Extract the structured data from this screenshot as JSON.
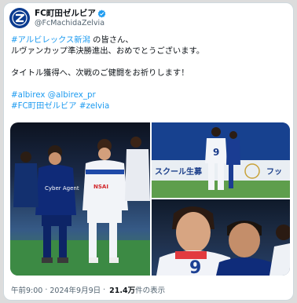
{
  "account": {
    "display_name": "FC町田ゼルビア",
    "handle": "@FcMachidaZelvia",
    "verified": true
  },
  "tweet": {
    "line1_tag": "#アルビレックス新潟",
    "line1_rest": " の皆さん、",
    "line2": "ルヴァンカップ準決勝進出、おめでとうございます。",
    "line3": "タイトル獲得へ、次戦のご健闘をお祈りします！",
    "line4_tag": "#albirex",
    "line4_mention": "@albirex_pr",
    "line5_tag1": "#FC町田ゼルビア",
    "line5_tag2": "#zelvia"
  },
  "media": {
    "sign_text": "スクール生募",
    "sign_text2": "フッ",
    "photo2_number": "9",
    "photo3_number": "9",
    "sponsor": "Cyber Agent",
    "sponsor2": "NSAI"
  },
  "meta": {
    "time": "午前9:00",
    "date": "2024年9月9日",
    "views": "21.4万",
    "views_label": "件の表示"
  },
  "colors": {
    "link": "#1d9bf0",
    "brand": "#0b3b8f"
  }
}
